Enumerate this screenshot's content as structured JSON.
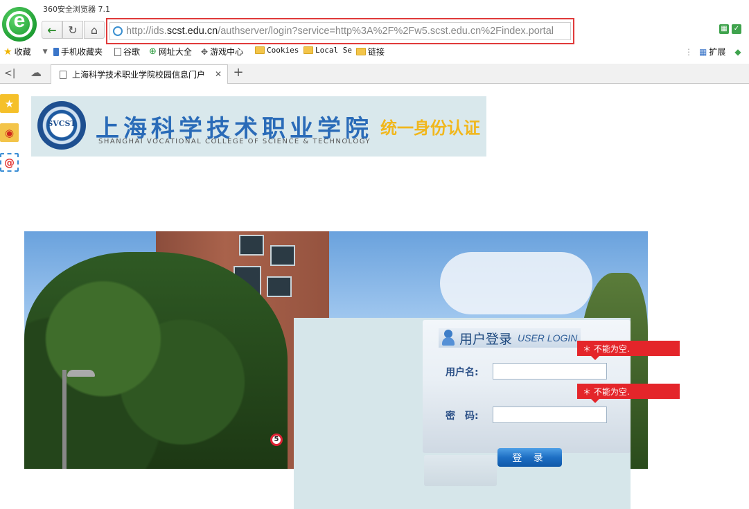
{
  "browser": {
    "title": "360安全浏览器 7.1",
    "url_prefix": "http://ids.",
    "url_host": "scst.edu.cn",
    "url_path": "/authserver/login?service=http%3A%2F%2Fw5.scst.edu.cn%2Findex.portal"
  },
  "bookmarks": {
    "favorites": "收藏",
    "mobile": "手机收藏夹",
    "google": "谷歌",
    "sites": "网址大全",
    "games": "游戏中心",
    "cookies": "Cookies",
    "local": "Local Se",
    "links": "链接",
    "extensions": "扩展"
  },
  "tab": {
    "title": "上海科学技术职业学院校园信息门户"
  },
  "banner": {
    "logo_text": "SVCST",
    "school_cn": "上海科学技术职业学院",
    "school_en": "SHANGHAI VOCATIONAL COLLEGE OF SCIENCE & TECHNOLOGY",
    "auth_text": "统一身份认证"
  },
  "photo": {
    "sign_number": "5"
  },
  "login": {
    "title": "用户登录",
    "title_en": "USER LOGIN",
    "username_label": "用户名:",
    "password_label": "密　码:",
    "username_value": "",
    "password_value": "",
    "username_error": "＊ 不能为空.",
    "password_error": "＊ 不能为空.",
    "submit_label": "登 录"
  },
  "colors": {
    "address_highlight": "#e03a3a",
    "error_bg": "#e4252a",
    "brand_blue": "#2a6bb8",
    "auth_yellow": "#f1b71c"
  }
}
